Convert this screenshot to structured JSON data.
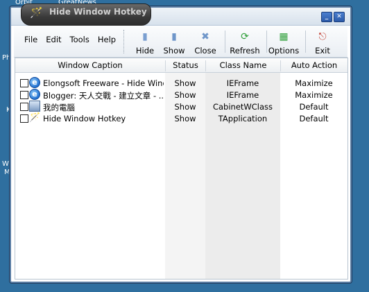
{
  "desktop": {
    "labels": [
      "Orbit",
      "GreatNews",
      "Ph",
      "K",
      "Wir",
      "Me"
    ]
  },
  "window": {
    "title": "Hide Window Hotkey",
    "title_icon": "wand-icon",
    "controls": {
      "minimize": "_",
      "close": "✕"
    }
  },
  "menu": [
    "File",
    "Edit",
    "Tools",
    "Help"
  ],
  "toolbar": {
    "buttons": [
      {
        "label": "Hide",
        "icon": "hide-window-icon"
      },
      {
        "label": "Show",
        "icon": "show-window-icon"
      },
      {
        "label": "Close",
        "icon": "close-window-icon"
      },
      {
        "label": "Refresh",
        "icon": "refresh-icon"
      },
      {
        "label": "Options",
        "icon": "options-icon"
      },
      {
        "label": "Exit",
        "icon": "exit-icon"
      }
    ]
  },
  "table": {
    "columns": [
      "Window Caption",
      "Status",
      "Class Name",
      "Auto Action"
    ],
    "rows": [
      {
        "caption": "Elongsoft Freeware - Hide Windo...",
        "status": "Show",
        "class": "IEFrame",
        "action": "Maximize",
        "icon": "ie-icon",
        "checked": false
      },
      {
        "caption": "Blogger: 天人交戰 - 建立文章 - ...",
        "status": "Show",
        "class": "IEFrame",
        "action": "Maximize",
        "icon": "ie-icon",
        "checked": false
      },
      {
        "caption": "我的電腦",
        "status": "Show",
        "class": "CabinetWClass",
        "action": "Default",
        "icon": "my-computer-icon",
        "checked": false
      },
      {
        "caption": "Hide Window Hotkey",
        "status": "Show",
        "class": "TApplication",
        "action": "Default",
        "icon": "wand-icon",
        "checked": false
      }
    ]
  },
  "colors": {
    "desktop": "#2f6f9f",
    "title_tab": "#3a3a3a",
    "window_border": "#5c7fa5"
  }
}
